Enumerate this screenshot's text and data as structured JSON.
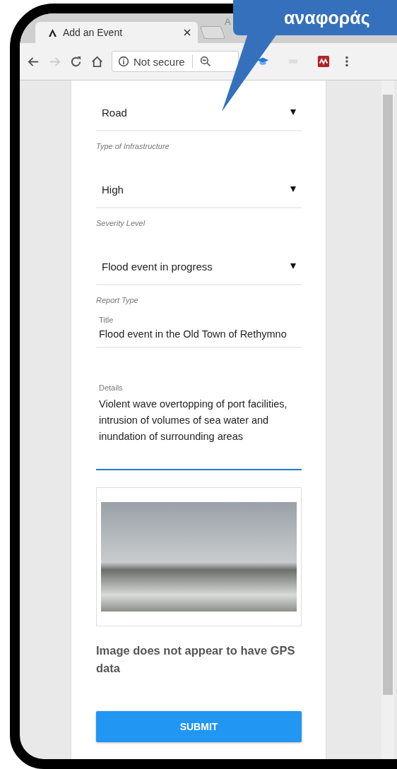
{
  "callout": {
    "text": "αναφοράς"
  },
  "window": {
    "title": "A"
  },
  "tabs": [
    {
      "label": "Add an Event",
      "selected": true
    }
  ],
  "toolbar": {
    "address": "Not secure",
    "forward_disabled": true
  },
  "form": {
    "selects": [
      {
        "value": "Road",
        "helper": "Type of Infrastructure"
      },
      {
        "value": "High",
        "helper": "Severity Level"
      },
      {
        "value": "Flood event in progress",
        "helper": "Report Type"
      }
    ],
    "title_field": {
      "label": "Title",
      "value": "Flood event in the Old Town of Rethymno",
      "focused": false
    },
    "details_field": {
      "label": "Details",
      "value": "Violent wave overtopping of port facilities, intrusion of volumes of sea water and inundation of surrounding areas",
      "focused": true
    },
    "gps_message": "Image does not appear to have GPS data",
    "submit": "SUBMIT"
  }
}
